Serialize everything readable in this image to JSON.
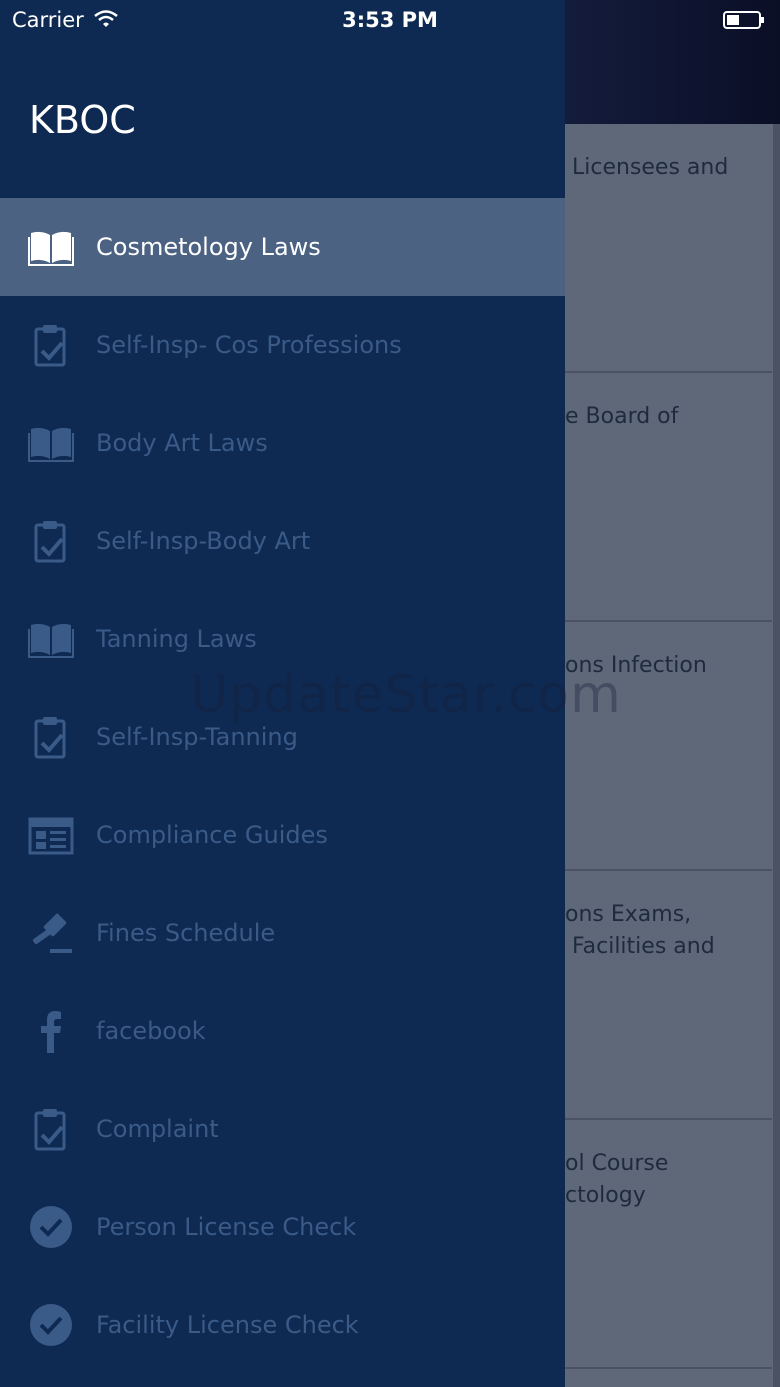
{
  "status_bar": {
    "carrier": "Carrier",
    "time": "3:53 PM"
  },
  "drawer": {
    "title": "KBOC",
    "items": [
      {
        "label": "Cosmetology Laws",
        "icon": "book-icon",
        "active": true
      },
      {
        "label": "Self-Insp- Cos Professions",
        "icon": "clipboard-check-icon"
      },
      {
        "label": "Body Art Laws",
        "icon": "book-icon"
      },
      {
        "label": "Self-Insp-Body Art",
        "icon": "clipboard-check-icon"
      },
      {
        "label": "Tanning Laws",
        "icon": "book-icon"
      },
      {
        "label": "Self-Insp-Tanning",
        "icon": "clipboard-check-icon"
      },
      {
        "label": "Compliance Guides",
        "icon": "newspaper-icon"
      },
      {
        "label": "Fines Schedule",
        "icon": "gavel-icon"
      },
      {
        "label": "facebook",
        "icon": "facebook-icon"
      },
      {
        "label": "Complaint",
        "icon": "clipboard-check-icon"
      },
      {
        "label": "Person License Check",
        "icon": "check-circle-icon"
      },
      {
        "label": "Facility License Check",
        "icon": "check-circle-icon"
      }
    ]
  },
  "background_list": [
    {
      "text": " Licensees and"
    },
    {
      "text": "e Board of"
    },
    {
      "text": "ons Infection"
    },
    {
      "text": "ons Exams,\n Facilities and"
    },
    {
      "text": "ol Course\nctology"
    }
  ],
  "watermark": "UpdateStar.com",
  "colors": {
    "drawer_bg": "#0f2a52",
    "active_bg": "#4b6283",
    "inactive_text": "#3a5a88",
    "active_text": "#ffffff"
  }
}
